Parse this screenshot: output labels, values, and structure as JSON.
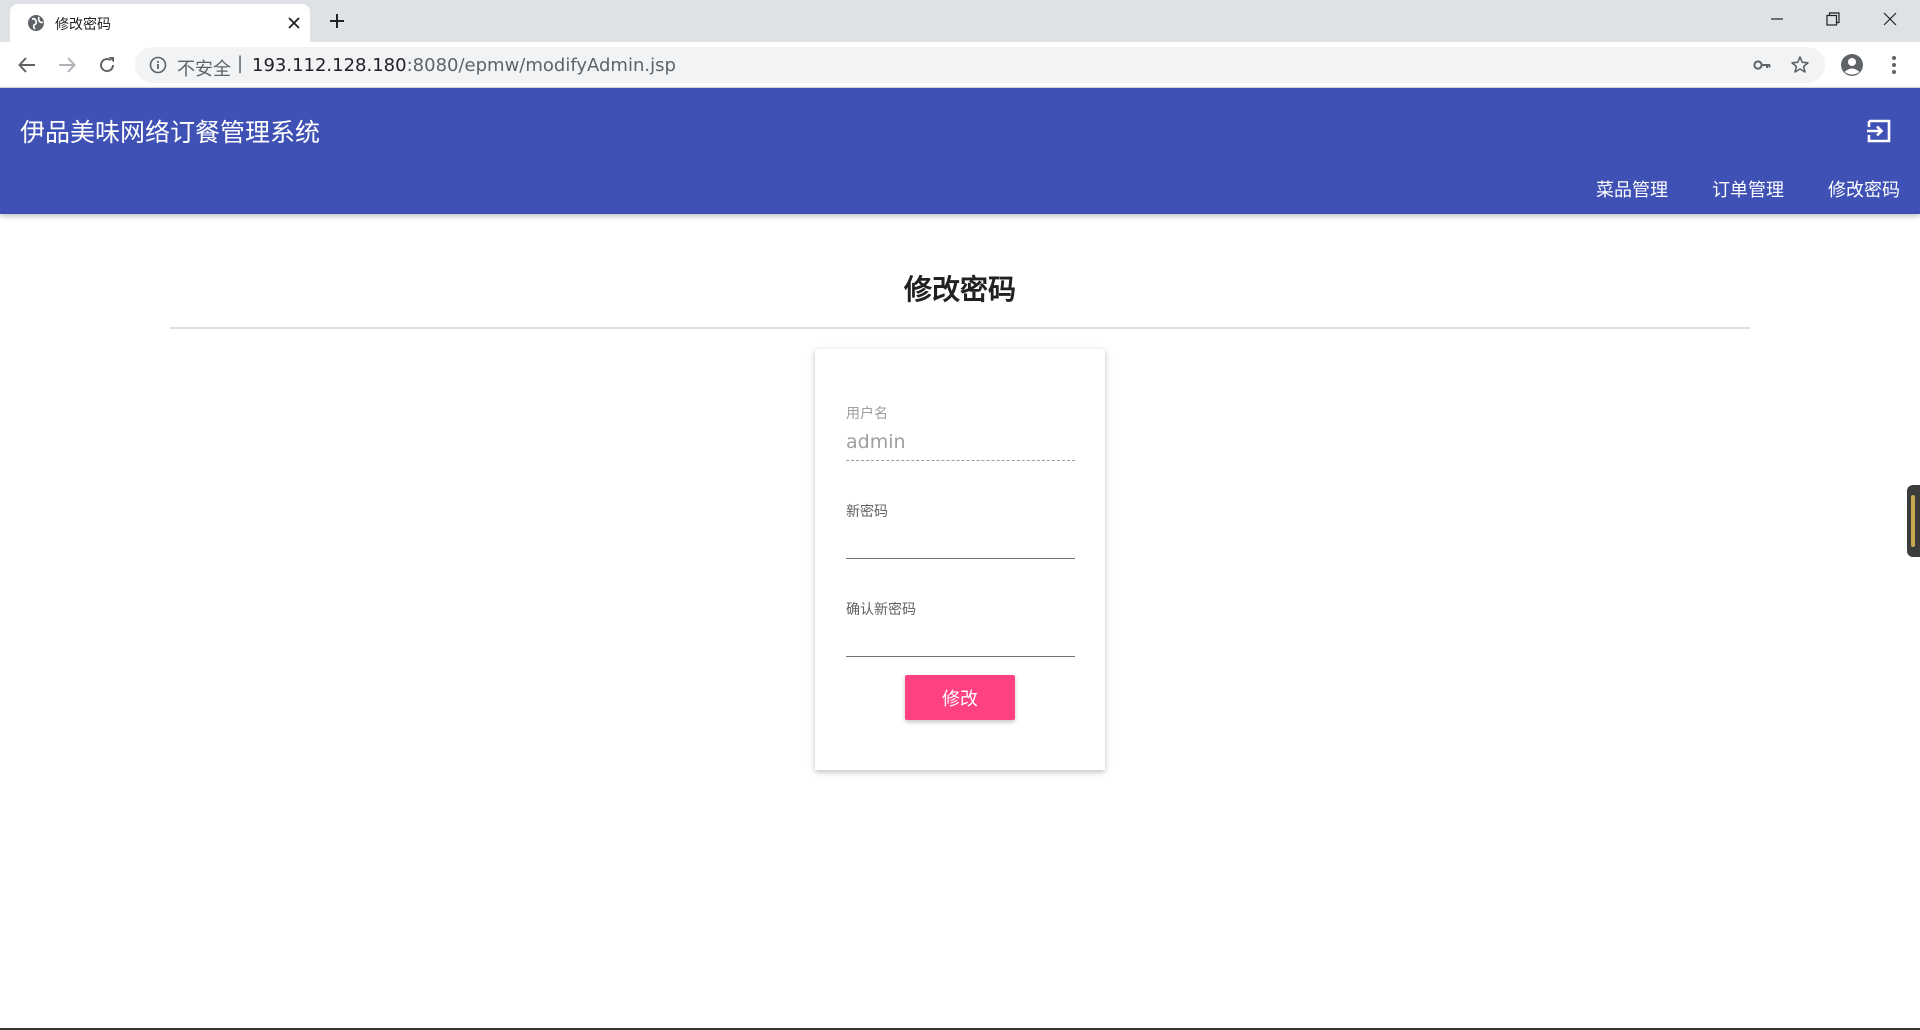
{
  "browser": {
    "tab_title": "修改密码",
    "security_label": "不安全",
    "separator": "|",
    "url_host": "193.112.128.180",
    "url_rest": ":8080/epmw/modifyAdmin.jsp"
  },
  "app": {
    "brand": "伊品美味网络订餐管理系统",
    "nav": [
      {
        "label": "菜品管理"
      },
      {
        "label": "订单管理"
      },
      {
        "label": "修改密码"
      }
    ]
  },
  "page": {
    "title": "修改密码"
  },
  "form": {
    "username_label": "用户名",
    "username_value": "admin",
    "new_password_label": "新密码",
    "confirm_password_label": "确认新密码",
    "submit_label": "修改"
  },
  "colors": {
    "header": "#3f51b5",
    "accent": "#ff4081"
  }
}
